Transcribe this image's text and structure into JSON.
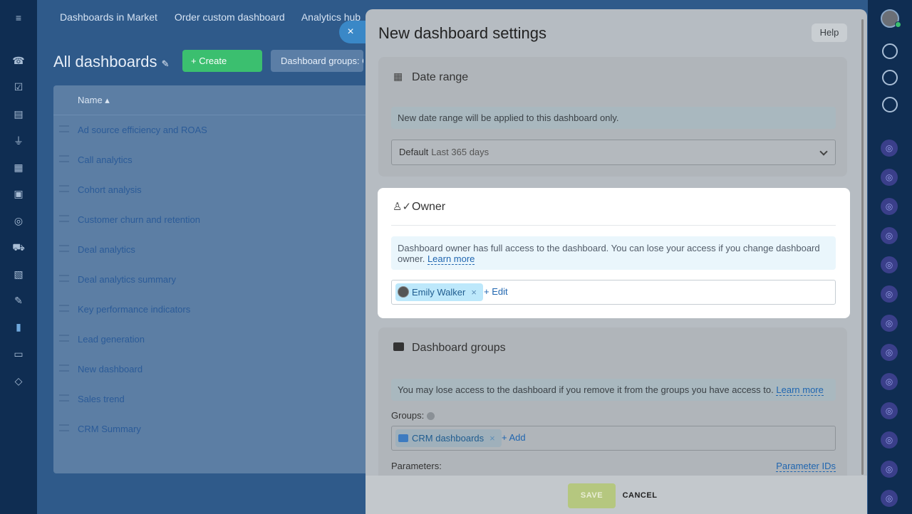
{
  "topnav": {
    "items": [
      "Dashboards in Market",
      "Order custom dashboard",
      "Analytics hub"
    ]
  },
  "page": {
    "title": "All dashboards",
    "create_label": "+ Create",
    "groups_filter_label": "Dashboard groups: C"
  },
  "table": {
    "header_name": "Name",
    "rows": [
      "Ad source efficiency and ROAS",
      "Call analytics",
      "Cohort analysis",
      "Customer churn and retention",
      "Deal analytics",
      "Deal analytics summary",
      "Key performance indicators",
      "Lead generation",
      "New dashboard",
      "Sales trend",
      "CRM Summary"
    ]
  },
  "panel": {
    "title": "New dashboard settings",
    "help_label": "Help",
    "close_glyph": "×"
  },
  "date_range": {
    "title": "Date range",
    "info": "New date range will be applied to this dashboard only.",
    "select_value": "Default",
    "select_sub": "Last 365 days"
  },
  "owner": {
    "title": "Owner",
    "info": "Dashboard owner has full access to the dashboard. You can lose your access if you change dashboard owner.",
    "learn_more": "Learn more",
    "chip_name": "Emily Walker",
    "chip_remove": "×",
    "edit_label": "+ Edit"
  },
  "groups": {
    "title": "Dashboard groups",
    "info": "You may lose access to the dashboard if you remove it from the groups you have access to.",
    "learn_more": "Learn more",
    "groups_label": "Groups:",
    "chip_name": "CRM dashboards",
    "chip_remove": "×",
    "add_label": "+ Add",
    "parameters_label": "Parameters:",
    "parameter_ids_label": "Parameter IDs"
  },
  "footer": {
    "save_label": "SAVE",
    "cancel_label": "CANCEL"
  },
  "colors": {
    "accent_green": "#3bbf6f",
    "link_blue": "#2066b0",
    "chip_blue": "#bde8fb"
  }
}
